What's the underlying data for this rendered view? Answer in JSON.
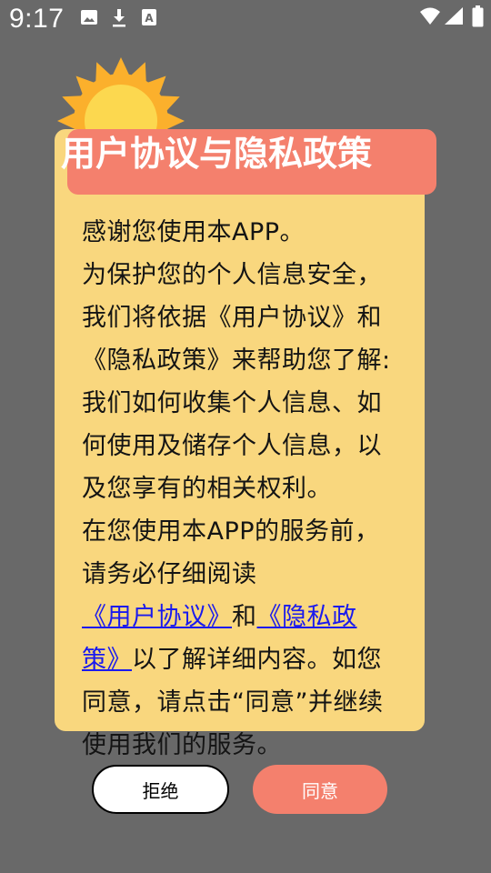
{
  "status_bar": {
    "time": "9:17",
    "left_icons": [
      "photo-icon",
      "download-icon",
      "a-notification-icon"
    ],
    "right_icons": [
      "wifi-icon",
      "signal-icon",
      "battery-icon"
    ]
  },
  "dialog": {
    "title": "用户协议与隐私政策",
    "intro": "感谢您使用本APP。",
    "body_part1": "为保护您的个人信息安全，我们将依据《用户协议》和《隐私政策》来帮助您了解: 我们如何收集个人信息、如何使用及储存个人信息，以及您享有的相关权利。",
    "body_part2": "在您使用本APP的服务前，请务必仔细阅读",
    "link_user_agreement": "《用户协议》",
    "and_text": "和",
    "link_privacy_policy": "《隐私政策》",
    "body_part3": "以了解详细内容。如您同意，请点击“同意”并继续使用我们的服务。",
    "reject_label": "拒绝",
    "agree_label": "同意"
  },
  "colors": {
    "backdrop": "#696969",
    "panel": "#f9d77e",
    "title_bar": "#f4806d",
    "agree_button": "#f4806d",
    "link": "#1a1aee"
  },
  "decoration": "sun-icon"
}
